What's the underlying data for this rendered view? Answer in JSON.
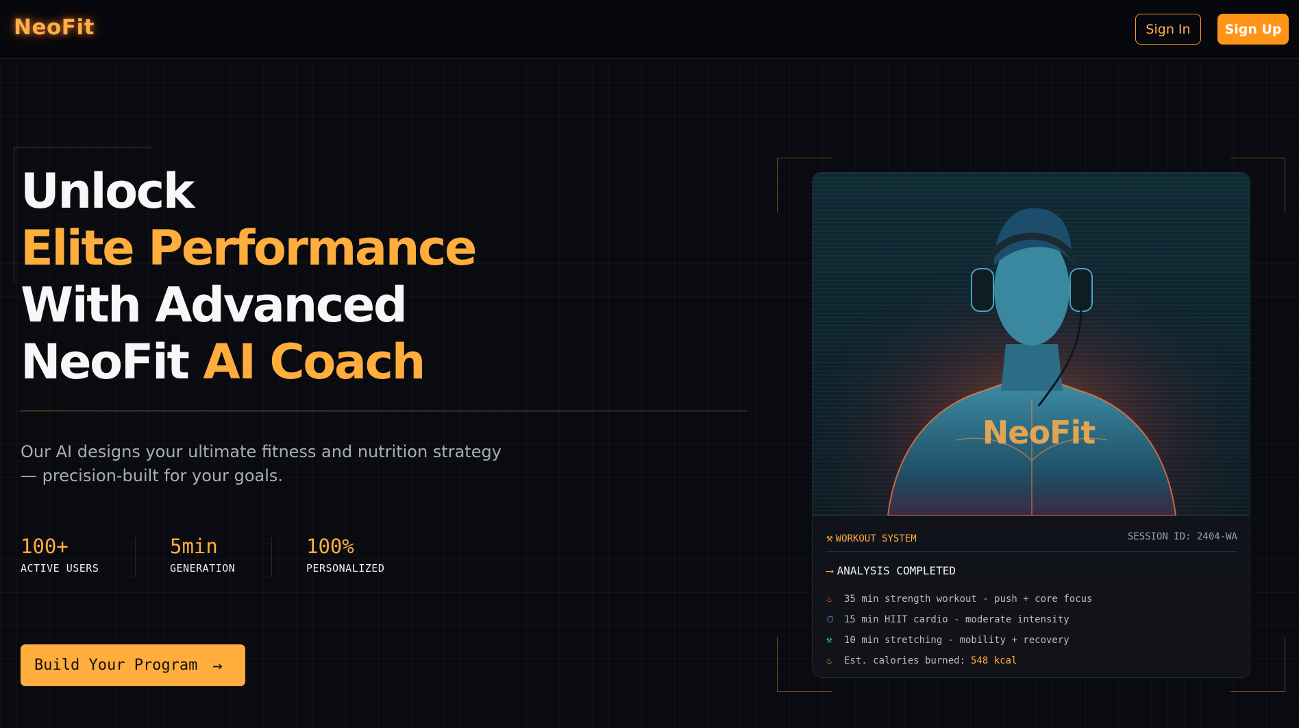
{
  "header": {
    "logo": "NeoFit",
    "sign_in": "Sign In",
    "sign_up": "Sign Up"
  },
  "hero": {
    "line1": "Unlock",
    "line2": "Elite Performance",
    "line3": "With Advanced",
    "line4_white": "NeoFit",
    "line4_accent": "AI Coach",
    "subtitle": "Our AI designs your ultimate fitness and nutrition strategy — precision-built for your goals.",
    "stats": [
      {
        "value": "100+",
        "label": "ACTIVE USERS"
      },
      {
        "value": "5min",
        "label": "GENERATION"
      },
      {
        "value": "100%",
        "label": "PERSONALIZED"
      }
    ],
    "cta": "Build Your Program"
  },
  "card": {
    "image_brand": "NeoFit",
    "system_label": "WORKOUT SYSTEM",
    "session": "SESSION ID: 2404-WA",
    "status": "ANALYSIS COMPLETED",
    "items": [
      {
        "icon": "flame-icon",
        "text": "35 min strength workout - push + core focus"
      },
      {
        "icon": "stopwatch-icon",
        "text": "15 min HIIT cardio - moderate intensity"
      },
      {
        "icon": "dumbbell-icon",
        "text": "10 min stretching - mobility + recovery"
      }
    ],
    "calories_label": "Est. calories burned:",
    "calories_value": "548 kcal"
  },
  "colors": {
    "accent": "#ffad3d",
    "button_orange": "#ff9416",
    "background": "#0a0b10"
  }
}
